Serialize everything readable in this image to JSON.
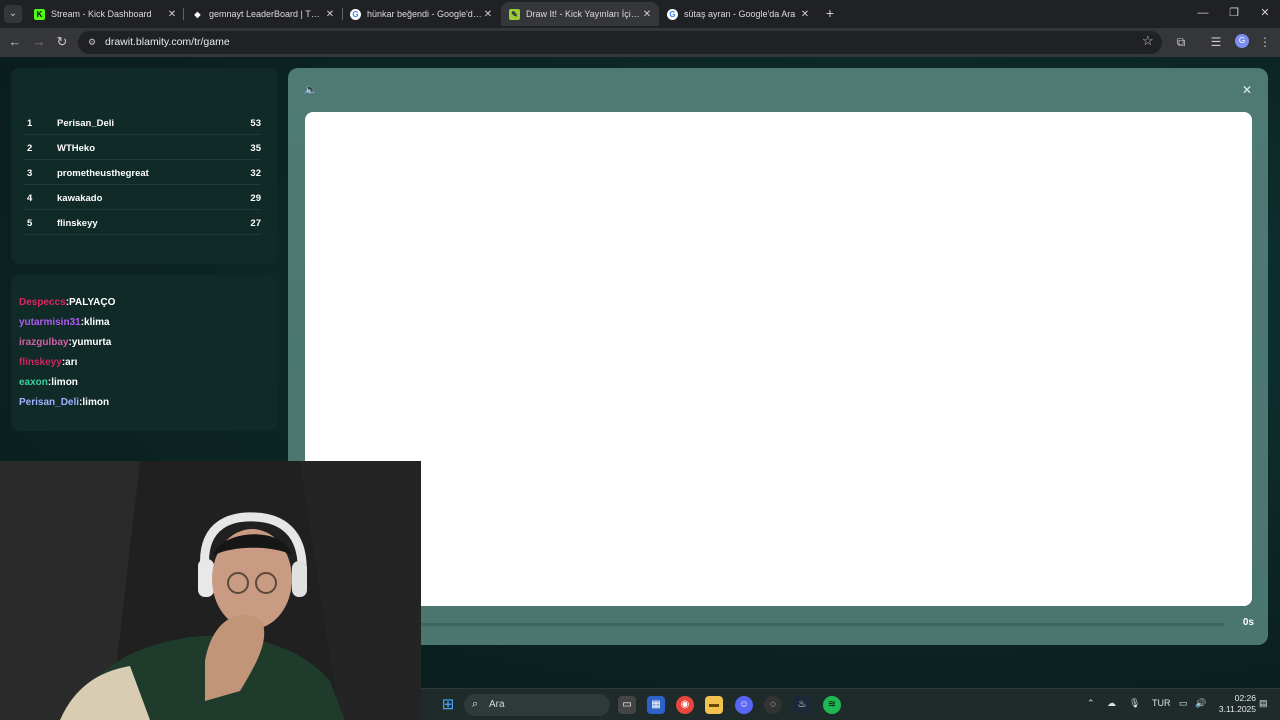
{
  "browser": {
    "tabs": [
      {
        "label": "Stream - Kick Dashboard",
        "active": false
      },
      {
        "label": "gemnayt LeaderBoard | The be",
        "active": false
      },
      {
        "label": "hünkar beğendi - Google'da Ar",
        "active": false
      },
      {
        "label": "Draw It! - Kick Yayınları İçin Çiz",
        "active": true
      },
      {
        "label": "sütaş ayran - Google'da Ara",
        "active": false
      }
    ],
    "url": "drawit.blamity.com/tr/game",
    "profile_initial": "G"
  },
  "leaderboard": [
    {
      "rank": "1",
      "name": "Perisan_Deli",
      "score": "53"
    },
    {
      "rank": "2",
      "name": "WTHeko",
      "score": "35"
    },
    {
      "rank": "3",
      "name": "prometheusthegreat",
      "score": "32"
    },
    {
      "rank": "4",
      "name": "kawakado",
      "score": "29"
    },
    {
      "rank": "5",
      "name": "flinskeyy",
      "score": "27"
    }
  ],
  "chat": [
    {
      "user": "Despeccs",
      "color": "#e0245e",
      "message": "PALYAÇO"
    },
    {
      "user": "yutarmisin31",
      "color": "#b05cf0",
      "message": "klima"
    },
    {
      "user": "irazgulbay",
      "color": "#d35fa8",
      "message": "yumurta"
    },
    {
      "user": "flinskeyy",
      "color": "#d0245e",
      "message": "arı"
    },
    {
      "user": "eaxon",
      "color": "#3ccf9c",
      "message": "limon"
    },
    {
      "user": "Perisan_Deli",
      "color": "#9fb3ff",
      "message": "limon"
    }
  ],
  "game": {
    "timer": "0s",
    "timer_progress": 0
  },
  "taskbar": {
    "search_placeholder": "Ara",
    "language": "TUR",
    "time": "02:26",
    "date": "3.11.2025"
  },
  "colors": {
    "page_bg": "#0b2524",
    "panel_bg": "#0f2a27",
    "game_panel": "#4f7a74",
    "canvas": "#ffffff"
  }
}
